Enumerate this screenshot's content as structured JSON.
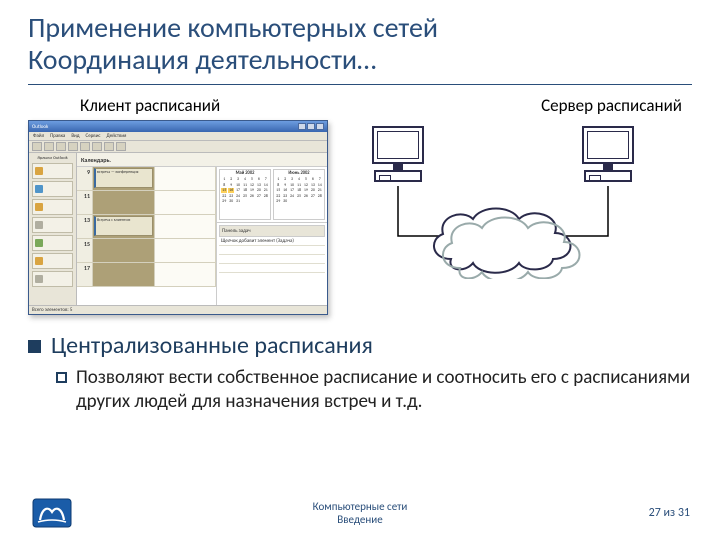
{
  "title_line1": "Применение компьютерных сетей",
  "title_line2": "Координация деятельности…",
  "labels": {
    "client": "Клиент расписаний",
    "server": "Сервер расписаний"
  },
  "app_mock": {
    "title": "Outlook",
    "menus": [
      "Файл",
      "Правка",
      "Вид",
      "Сервис",
      "Действия"
    ],
    "side_header": "Ярлыки Outlook",
    "main_header": "Календарь.",
    "times": [
      "9",
      "11",
      "13",
      "15",
      "17"
    ],
    "appt1": "встреча — конференция",
    "appt2": "Встреча с клиентом",
    "cal1_title": "Май 2002",
    "cal2_title": "Июнь 2002",
    "tasks_head": "Панель задач",
    "tasks_hint": "Щелчок добавит элемент (Задача)",
    "status": "Всего элементов: 5"
  },
  "bullets": {
    "l1": "Централизованные расписания",
    "l2": "Позволяют вести собственное расписание и соотносить его с расписаниями других людей для назначения встреч и т.д."
  },
  "footer": {
    "center_l1": "Компьютерные сети",
    "center_l2": "Введение",
    "page": "27 из 31"
  }
}
